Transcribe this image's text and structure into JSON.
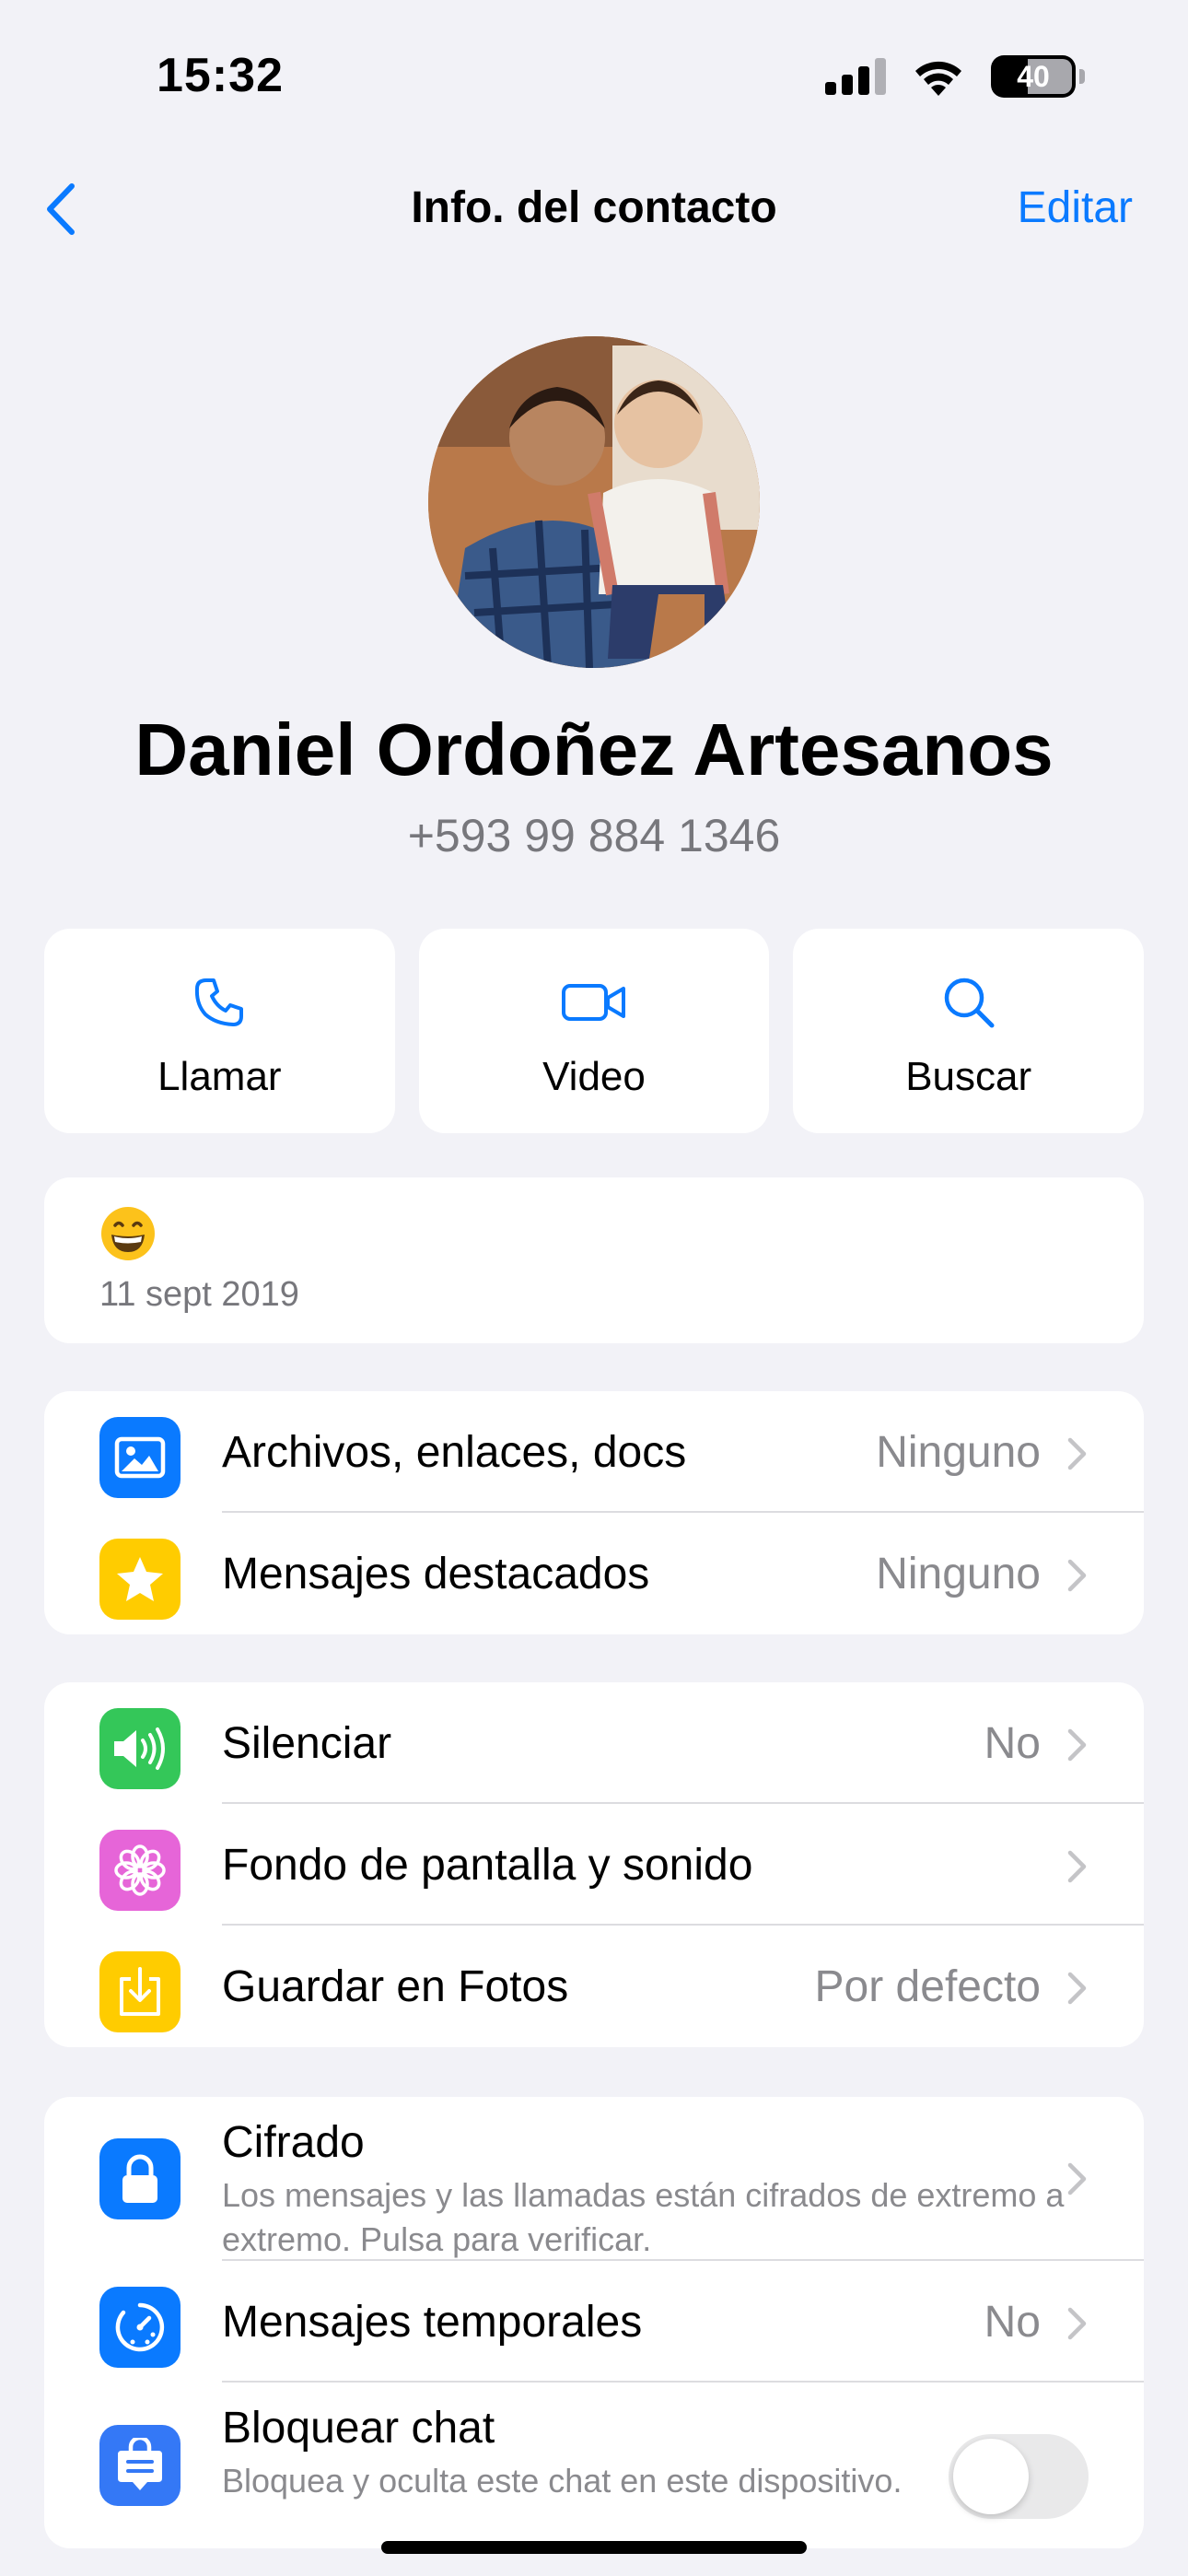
{
  "status_bar": {
    "time": "15:32",
    "battery": "40"
  },
  "nav": {
    "title": "Info. del contacto",
    "edit_label": "Editar"
  },
  "contact": {
    "name": "Daniel Ordoñez Artesanos",
    "phone": "+593 99 884 1346"
  },
  "actions": [
    {
      "label": "Llamar",
      "icon": "phone-icon"
    },
    {
      "label": "Video",
      "icon": "video-camera-icon"
    },
    {
      "label": "Buscar",
      "icon": "search-icon"
    }
  ],
  "about": {
    "emoji": "grinning-face-icon",
    "date": "11 sept 2019"
  },
  "section_media": [
    {
      "label": "Archivos, enlaces, docs",
      "value": "Ninguno",
      "icon": "photo-icon",
      "color": "#0a7aff"
    },
    {
      "label": "Mensajes destacados",
      "value": "Ninguno",
      "icon": "star-icon",
      "color": "#ffcc00"
    }
  ],
  "section_settings": [
    {
      "label": "Silenciar",
      "value": "No",
      "icon": "speaker-icon",
      "color": "#34c759"
    },
    {
      "label": "Fondo de pantalla y sonido",
      "value": "",
      "icon": "flower-icon",
      "color": "#e665d8"
    },
    {
      "label": "Guardar en Fotos",
      "value": "Por defecto",
      "icon": "download-icon",
      "color": "#ffcc00"
    }
  ],
  "section_privacy": [
    {
      "label": "Cifrado",
      "subtitle": "Los mensajes y las llamadas están cifrados de extremo a extremo. Pulsa para verificar.",
      "icon": "lock-icon",
      "color": "#0a7aff"
    },
    {
      "label": "Mensajes temporales",
      "value": "No",
      "icon": "timer-icon",
      "color": "#0a7aff"
    },
    {
      "label": "Bloquear chat",
      "subtitle": "Bloquea y oculta este chat en este dispositivo.",
      "icon": "chat-lock-icon",
      "color": "#3478f6",
      "toggle": false
    }
  ],
  "colors": {
    "accent": "#0a7aff",
    "background": "#f2f2f7",
    "secondary_text": "#8a8a8e"
  }
}
